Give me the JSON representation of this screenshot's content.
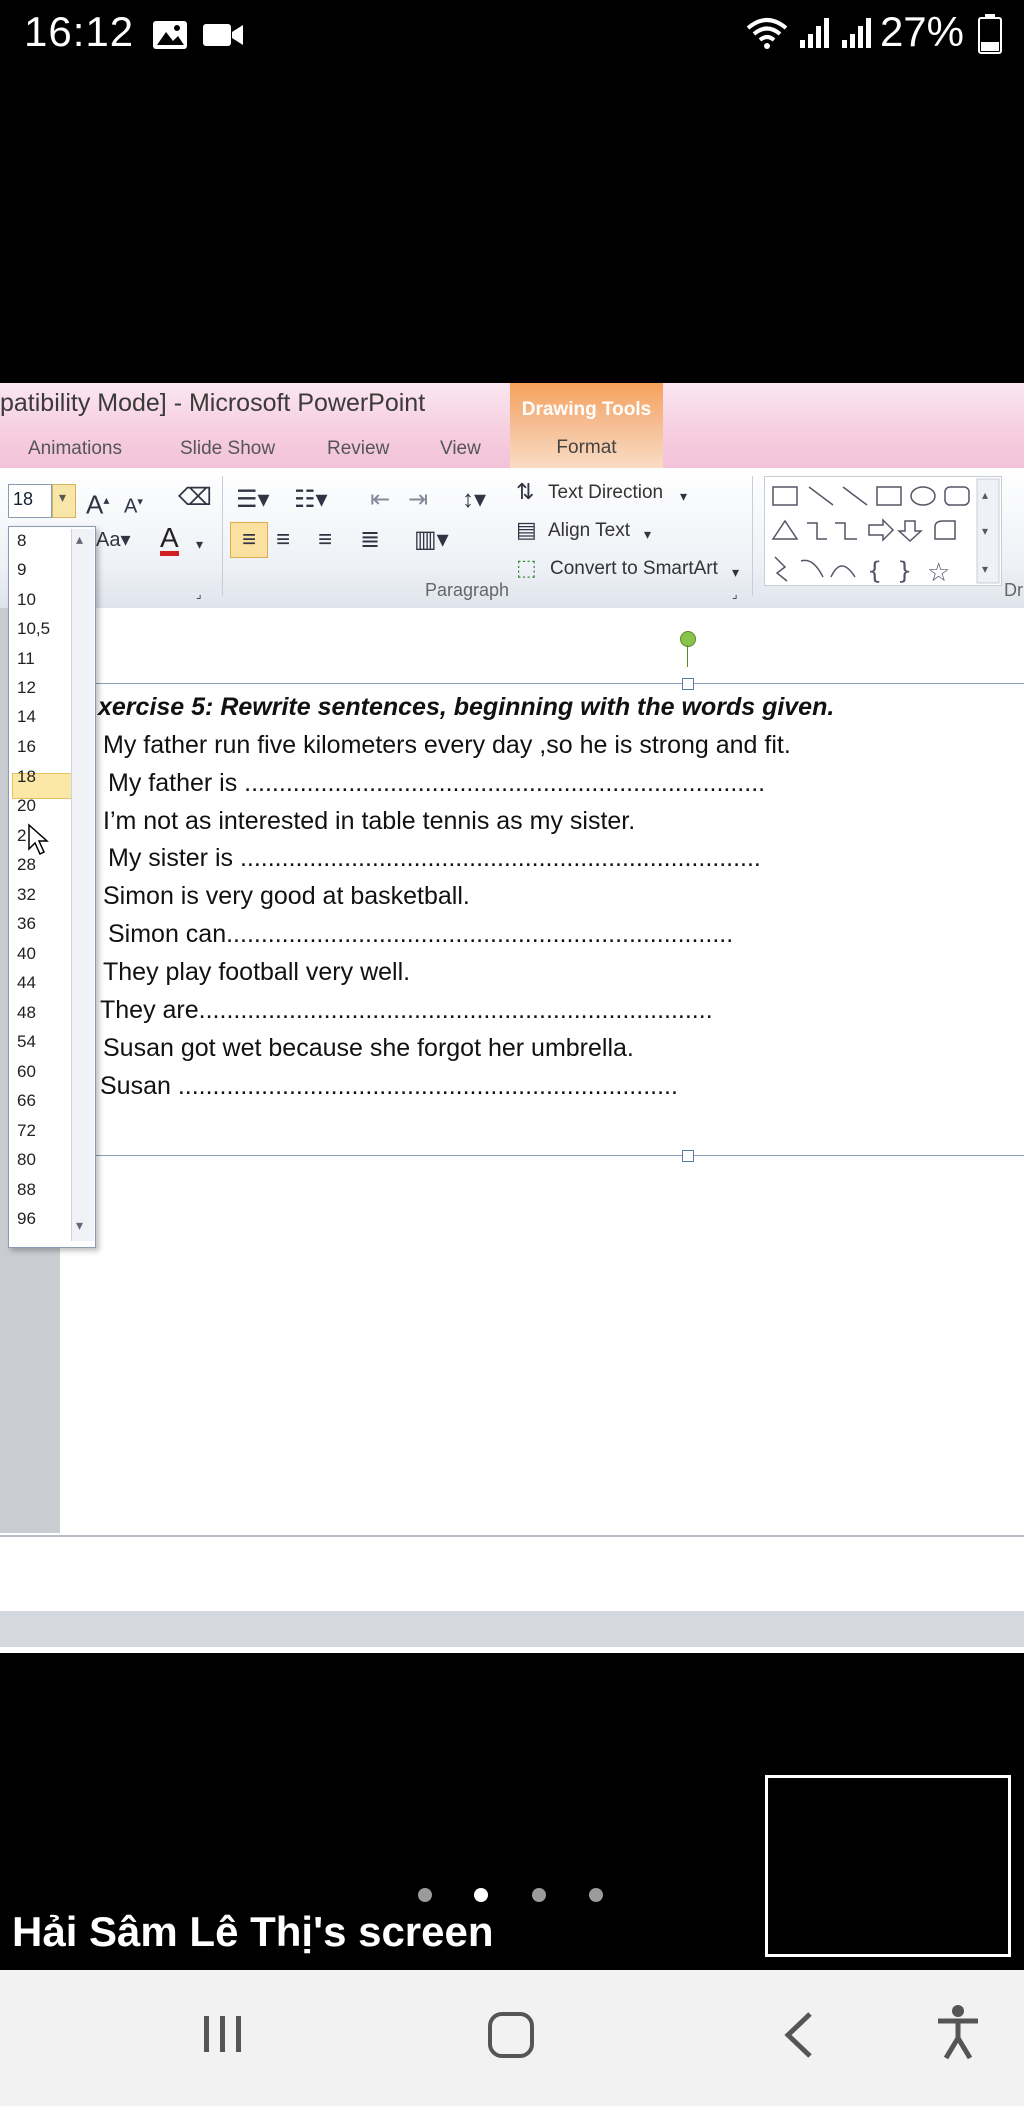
{
  "status": {
    "time": "16:12",
    "battery": "27%",
    "icons": [
      "image-icon",
      "video-camera-icon",
      "wifi-icon",
      "signal-icon",
      "signal-icon",
      "battery-icon"
    ]
  },
  "window": {
    "title": "patibility Mode] - Microsoft PowerPoint",
    "contextual_group": "Drawing Tools",
    "tabs": [
      "Animations",
      "Slide Show",
      "Review",
      "View",
      "Format"
    ]
  },
  "ribbon": {
    "font_size_value": "18",
    "text_direction": "Text Direction",
    "align_text": "Align Text",
    "convert_smartart": "Convert to SmartArt",
    "paragraph_group": "Paragraph",
    "drawing_group_fragment": "Dr"
  },
  "font_sizes": [
    "8",
    "9",
    "10",
    "10,5",
    "11",
    "12",
    "14",
    "16",
    "18",
    "20",
    "2",
    "28",
    "32",
    "36",
    "40",
    "44",
    "48",
    "54",
    "60",
    "66",
    "72",
    "80",
    "88",
    "96"
  ],
  "selected_font_size": "18",
  "slide": {
    "exercise_title": "xercise 5: Rewrite sentences, beginning with the words given.",
    "lines": [
      "My father run five kilometers every day ,so he is strong and fit.",
      "My father is ...........................................................................",
      "I’m not as interested in table tennis as my sister.",
      "My sister is ...........................................................................",
      "Simon is very good at basketball.",
      "Simon can.........................................................................",
      "They play football very well.",
      "They are..........................................................................",
      "Susan got wet because she forgot her umbrella.",
      "Susan ........................................................................"
    ]
  },
  "screen_share": {
    "owner_label": "Hải Sâm Lê Thị's screen"
  }
}
